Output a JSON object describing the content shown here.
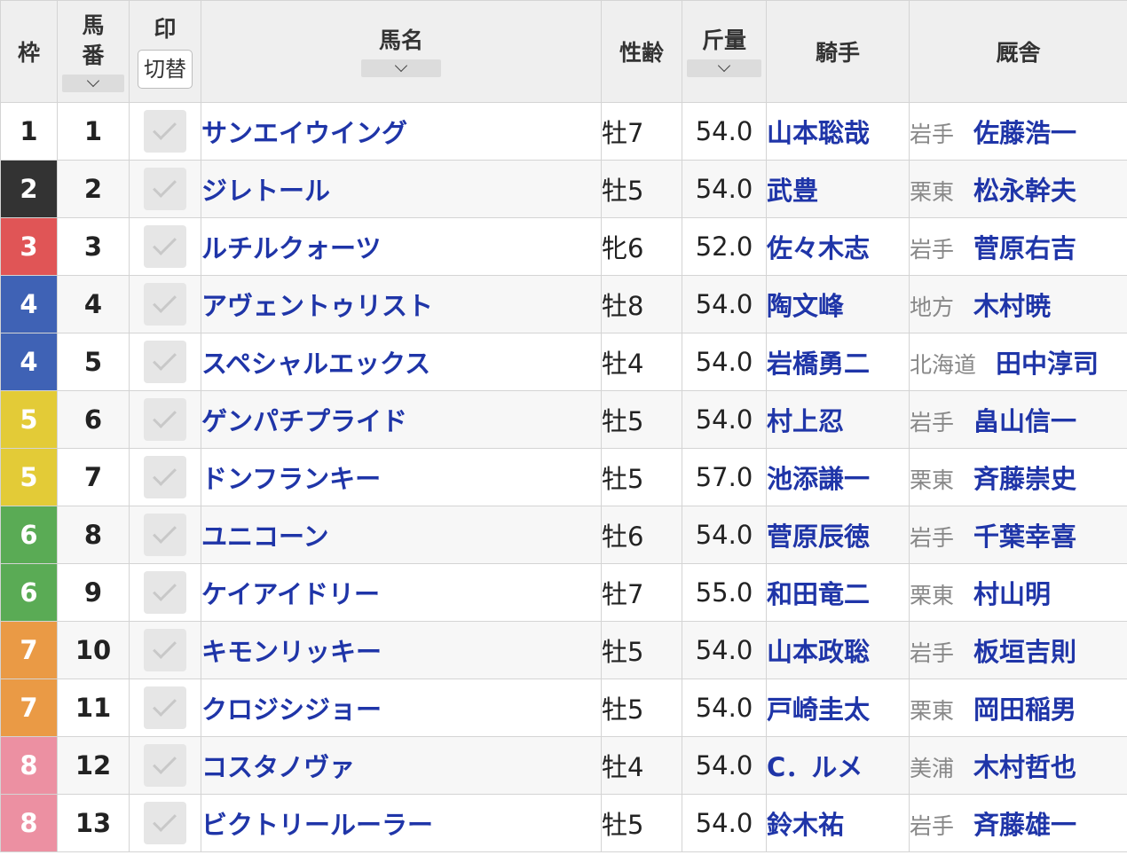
{
  "headers": {
    "waku": "枠",
    "umaban_1": "馬",
    "umaban_2": "番",
    "mark": "印",
    "mark_toggle": "切替",
    "horse_name": "馬名",
    "sex_age": "性齢",
    "weight": "斤量",
    "jockey": "騎手",
    "trainer": "厩舎"
  },
  "waku_colors": {
    "1": {
      "bg": "#ffffff",
      "fg": "#222222"
    },
    "2": {
      "bg": "#333333",
      "fg": "#ffffff"
    },
    "3": {
      "bg": "#e05556",
      "fg": "#ffffff"
    },
    "4": {
      "bg": "#3f62b5",
      "fg": "#ffffff"
    },
    "5": {
      "bg": "#e3cb37",
      "fg": "#ffffff"
    },
    "6": {
      "bg": "#5aab55",
      "fg": "#ffffff"
    },
    "7": {
      "bg": "#ea9a45",
      "fg": "#ffffff"
    },
    "8": {
      "bg": "#ec90a2",
      "fg": "#ffffff"
    }
  },
  "rows": [
    {
      "waku": "1",
      "umaban": "1",
      "name": "サンエイウイング",
      "sex_age": "牡7",
      "weight": "54.0",
      "jockey": "山本聡哉",
      "region": "岩手",
      "trainer": "佐藤浩一"
    },
    {
      "waku": "2",
      "umaban": "2",
      "name": "ジレトール",
      "sex_age": "牡5",
      "weight": "54.0",
      "jockey": "武豊",
      "region": "栗東",
      "trainer": "松永幹夫"
    },
    {
      "waku": "3",
      "umaban": "3",
      "name": "ルチルクォーツ",
      "sex_age": "牝6",
      "weight": "52.0",
      "jockey": "佐々木志",
      "region": "岩手",
      "trainer": "菅原右吉"
    },
    {
      "waku": "4",
      "umaban": "4",
      "name": "アヴェントゥリスト",
      "sex_age": "牡8",
      "weight": "54.0",
      "jockey": "陶文峰",
      "region": "地方",
      "trainer": "木村暁"
    },
    {
      "waku": "4",
      "umaban": "5",
      "name": "スペシャルエックス",
      "sex_age": "牡4",
      "weight": "54.0",
      "jockey": "岩橋勇二",
      "region": "北海道",
      "trainer": "田中淳司"
    },
    {
      "waku": "5",
      "umaban": "6",
      "name": "ゲンパチプライド",
      "sex_age": "牡5",
      "weight": "54.0",
      "jockey": "村上忍",
      "region": "岩手",
      "trainer": "畠山信一"
    },
    {
      "waku": "5",
      "umaban": "7",
      "name": "ドンフランキー",
      "sex_age": "牡5",
      "weight": "57.0",
      "jockey": "池添謙一",
      "region": "栗東",
      "trainer": "斉藤崇史"
    },
    {
      "waku": "6",
      "umaban": "8",
      "name": "ユニコーン",
      "sex_age": "牡6",
      "weight": "54.0",
      "jockey": "菅原辰徳",
      "region": "岩手",
      "trainer": "千葉幸喜"
    },
    {
      "waku": "6",
      "umaban": "9",
      "name": "ケイアイドリー",
      "sex_age": "牡7",
      "weight": "55.0",
      "jockey": "和田竜二",
      "region": "栗東",
      "trainer": "村山明"
    },
    {
      "waku": "7",
      "umaban": "10",
      "name": "キモンリッキー",
      "sex_age": "牡5",
      "weight": "54.0",
      "jockey": "山本政聡",
      "region": "岩手",
      "trainer": "板垣吉則"
    },
    {
      "waku": "7",
      "umaban": "11",
      "name": "クロジシジョー",
      "sex_age": "牡5",
      "weight": "54.0",
      "jockey": "戸崎圭太",
      "region": "栗東",
      "trainer": "岡田稲男"
    },
    {
      "waku": "8",
      "umaban": "12",
      "name": "コスタノヴァ",
      "sex_age": "牡4",
      "weight": "54.0",
      "jockey": "C．ルメ",
      "region": "美浦",
      "trainer": "木村哲也"
    },
    {
      "waku": "8",
      "umaban": "13",
      "name": "ビクトリールーラー",
      "sex_age": "牡5",
      "weight": "54.0",
      "jockey": "鈴木祐",
      "region": "岩手",
      "trainer": "斉藤雄一"
    }
  ]
}
